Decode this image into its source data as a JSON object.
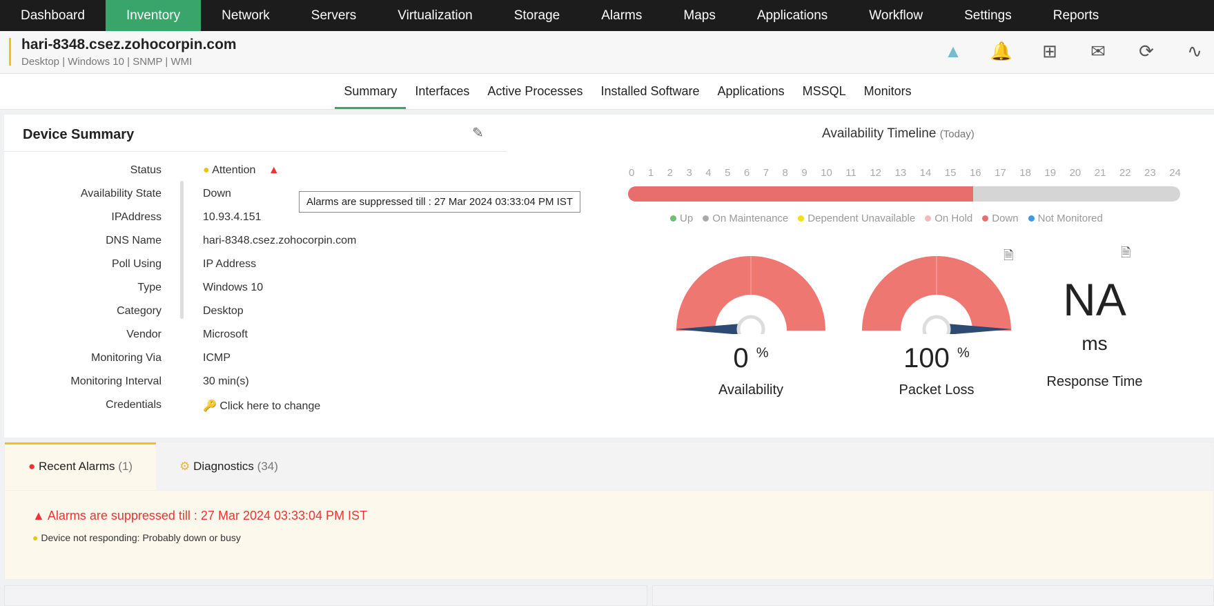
{
  "nav": [
    "Dashboard",
    "Inventory",
    "Network",
    "Servers",
    "Virtualization",
    "Storage",
    "Alarms",
    "Maps",
    "Applications",
    "Workflow",
    "Settings",
    "Reports"
  ],
  "device": {
    "name": "hari-8348.csez.zohocorpin.com",
    "sub": "Desktop | Windows 10  | SNMP  | WMI"
  },
  "tabs": [
    "Summary",
    "Interfaces",
    "Active Processes",
    "Installed Software",
    "Applications",
    "MSSQL",
    "Monitors"
  ],
  "summary": {
    "title": "Device Summary",
    "rows": [
      {
        "k": "Status",
        "v": "Attention"
      },
      {
        "k": "Availability State",
        "v": "Down"
      },
      {
        "k": "IPAddress",
        "v": "10.93.4.151"
      },
      {
        "k": "DNS Name",
        "v": "hari-8348.csez.zohocorpin.com"
      },
      {
        "k": "Poll Using",
        "v": "IP Address"
      },
      {
        "k": "Type",
        "v": "Windows 10"
      },
      {
        "k": "Category",
        "v": "Desktop"
      },
      {
        "k": "Vendor",
        "v": "Microsoft"
      },
      {
        "k": "Monitoring Via",
        "v": "ICMP"
      },
      {
        "k": "Monitoring Interval",
        "v": "30 min(s)"
      },
      {
        "k": "Credentials",
        "v": "Click here to change"
      }
    ],
    "tooltip": "Alarms are suppressed till : 27 Mar 2024 03:33:04 PM IST"
  },
  "timeline": {
    "title": "Availability Timeline",
    "period": "(Today)",
    "hours": [
      "0",
      "1",
      "2",
      "3",
      "4",
      "5",
      "6",
      "7",
      "8",
      "9",
      "10",
      "11",
      "12",
      "13",
      "14",
      "15",
      "16",
      "17",
      "18",
      "19",
      "20",
      "21",
      "22",
      "23",
      "24"
    ],
    "down_until_hour": 15,
    "legend": [
      {
        "label": "Up",
        "color": "#6cc070"
      },
      {
        "label": "On Maintenance",
        "color": "#aaaaaa"
      },
      {
        "label": "Dependent Unavailable",
        "color": "#f2e01a"
      },
      {
        "label": "On Hold",
        "color": "#f4b9c0"
      },
      {
        "label": "Down",
        "color": "#e86e6e"
      },
      {
        "label": "Not Monitored",
        "color": "#3a9be8"
      }
    ]
  },
  "gauges": {
    "availability": {
      "value": "0",
      "unit": "%",
      "label": "Availability"
    },
    "packet_loss": {
      "value": "100",
      "unit": "%",
      "label": "Packet Loss"
    },
    "response": {
      "value": "NA",
      "unit": "ms",
      "label": "Response Time"
    }
  },
  "alarms": {
    "tab1": "Recent Alarms",
    "tab1_count": "(1)",
    "tab2": "Diagnostics",
    "tab2_count": "(34)",
    "msg": "Alarms are suppressed till : 27 Mar 2024 03:33:04 PM IST",
    "msg2": "Device not responding: Probably down or busy"
  }
}
